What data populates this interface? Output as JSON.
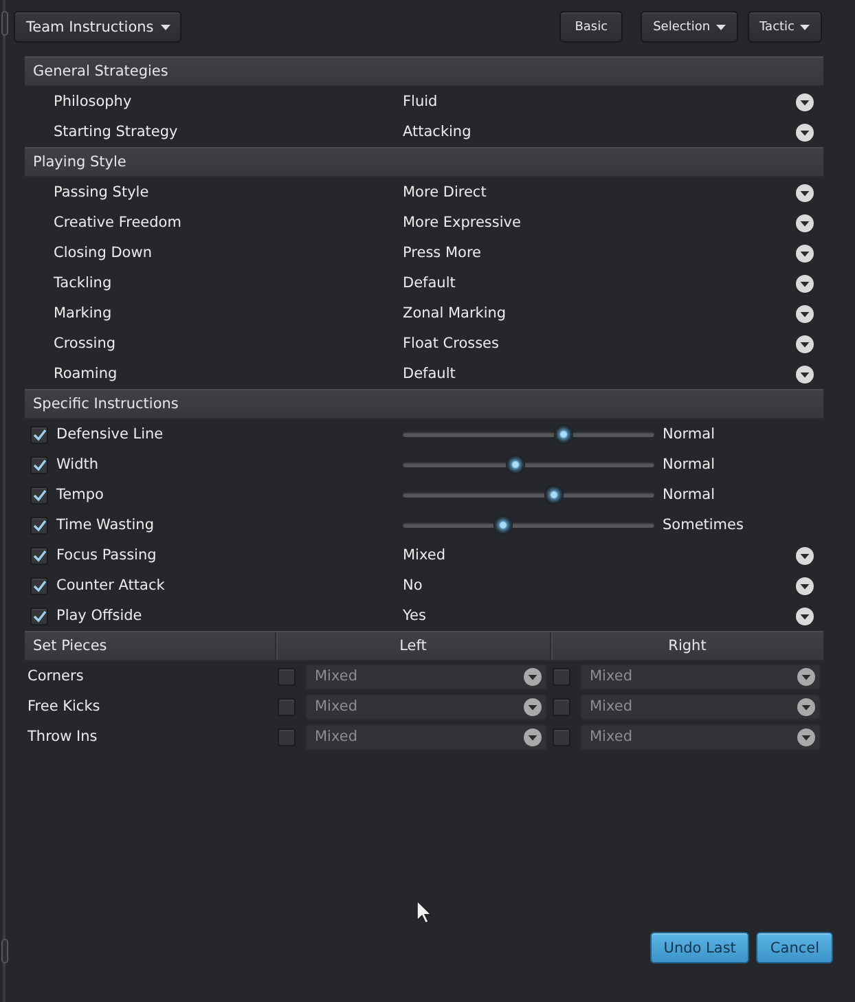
{
  "toolbar": {
    "menu": {
      "label": "Team Instructions"
    },
    "buttons": [
      {
        "label": "Basic",
        "dropdown": false
      },
      {
        "label": "Selection",
        "dropdown": true
      },
      {
        "label": "Tactic",
        "dropdown": true
      }
    ]
  },
  "sections": [
    {
      "title": "General Strategies",
      "rows": [
        {
          "kind": "dropdown",
          "label": "Philosophy",
          "value": "Fluid"
        },
        {
          "kind": "dropdown",
          "label": "Starting Strategy",
          "value": "Attacking"
        }
      ]
    },
    {
      "title": "Playing Style",
      "rows": [
        {
          "kind": "dropdown",
          "label": "Passing Style",
          "value": "More Direct"
        },
        {
          "kind": "dropdown",
          "label": "Creative Freedom",
          "value": "More Expressive"
        },
        {
          "kind": "dropdown",
          "label": "Closing Down",
          "value": "Press More"
        },
        {
          "kind": "dropdown",
          "label": "Tackling",
          "value": "Default"
        },
        {
          "kind": "dropdown",
          "label": "Marking",
          "value": "Zonal Marking"
        },
        {
          "kind": "dropdown",
          "label": "Crossing",
          "value": "Float Crosses"
        },
        {
          "kind": "dropdown",
          "label": "Roaming",
          "value": "Default"
        }
      ]
    },
    {
      "title": "Specific Instructions",
      "rows": [
        {
          "kind": "slider",
          "label": "Defensive Line",
          "checked": true,
          "level": 0.64,
          "reading": "Normal"
        },
        {
          "kind": "slider",
          "label": "Width",
          "checked": true,
          "level": 0.45,
          "reading": "Normal"
        },
        {
          "kind": "slider",
          "label": "Tempo",
          "checked": true,
          "level": 0.6,
          "reading": "Normal"
        },
        {
          "kind": "slider",
          "label": "Time Wasting",
          "checked": true,
          "level": 0.4,
          "reading": "Sometimes"
        },
        {
          "kind": "dropdown",
          "label": "Focus Passing",
          "checked": true,
          "value": "Mixed"
        },
        {
          "kind": "dropdown",
          "label": "Counter Attack",
          "checked": true,
          "value": "No"
        },
        {
          "kind": "dropdown",
          "label": "Play Offside",
          "checked": true,
          "value": "Yes"
        }
      ]
    }
  ],
  "set_pieces": {
    "title": "Set Pieces",
    "columns": [
      "Left",
      "Right"
    ],
    "rows": [
      {
        "label": "Corners",
        "cells": [
          {
            "checked": false,
            "value": "Mixed",
            "disabled": true
          },
          {
            "checked": false,
            "value": "Mixed",
            "disabled": true
          }
        ]
      },
      {
        "label": "Free Kicks",
        "cells": [
          {
            "checked": false,
            "value": "Mixed",
            "disabled": true
          },
          {
            "checked": false,
            "value": "Mixed",
            "disabled": true
          }
        ]
      },
      {
        "label": "Throw Ins",
        "cells": [
          {
            "checked": false,
            "value": "Mixed",
            "disabled": true
          },
          {
            "checked": false,
            "value": "Mixed",
            "disabled": true
          }
        ]
      }
    ]
  },
  "actions": [
    {
      "label": "Undo Last"
    },
    {
      "label": "Cancel"
    }
  ]
}
